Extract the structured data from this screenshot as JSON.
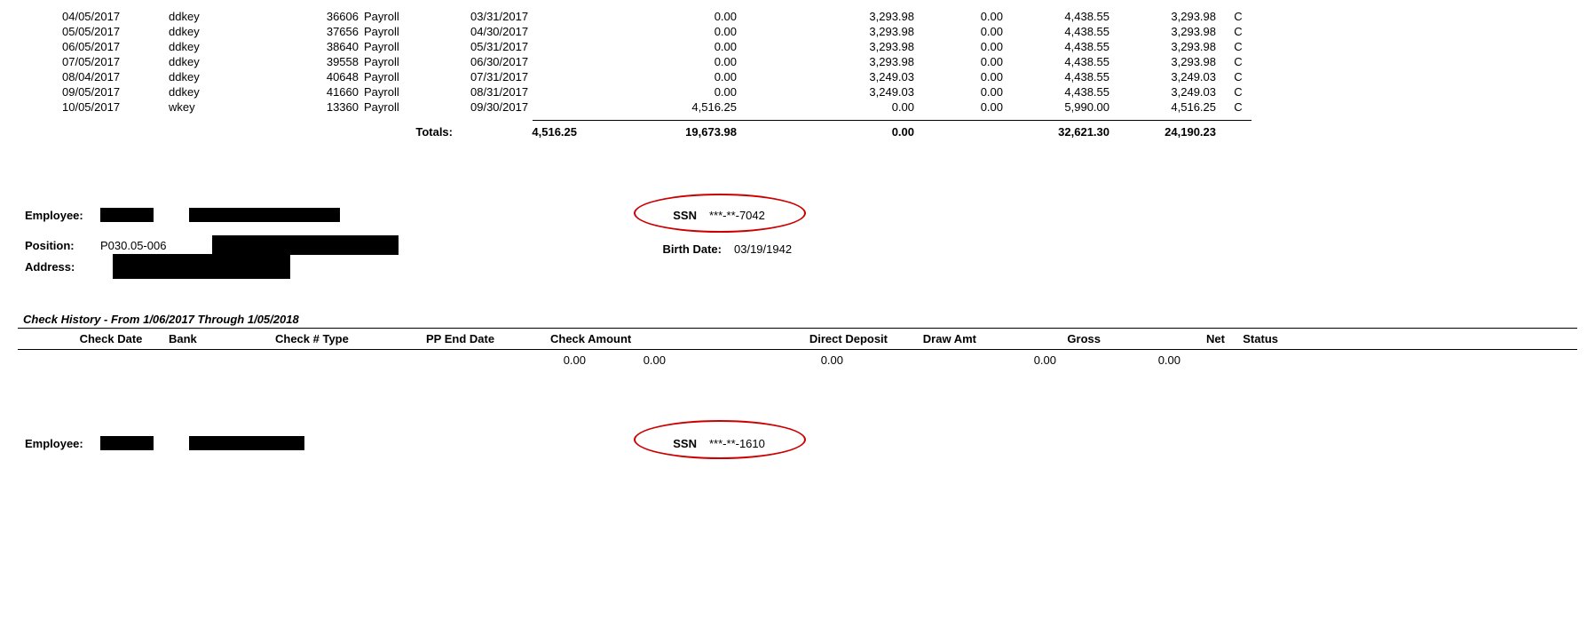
{
  "rows": [
    {
      "date": "04/05/2017",
      "bank": "ddkey",
      "chk": "36606",
      "type": "Payroll",
      "pp": "03/31/2017",
      "a1": "",
      "a2": "0.00",
      "dd": "3,293.98",
      "draw": "0.00",
      "gross": "4,438.55",
      "net": "3,293.98",
      "st": "C"
    },
    {
      "date": "05/05/2017",
      "bank": "ddkey",
      "chk": "37656",
      "type": "Payroll",
      "pp": "04/30/2017",
      "a1": "",
      "a2": "0.00",
      "dd": "3,293.98",
      "draw": "0.00",
      "gross": "4,438.55",
      "net": "3,293.98",
      "st": "C"
    },
    {
      "date": "06/05/2017",
      "bank": "ddkey",
      "chk": "38640",
      "type": "Payroll",
      "pp": "05/31/2017",
      "a1": "",
      "a2": "0.00",
      "dd": "3,293.98",
      "draw": "0.00",
      "gross": "4,438.55",
      "net": "3,293.98",
      "st": "C"
    },
    {
      "date": "07/05/2017",
      "bank": "ddkey",
      "chk": "39558",
      "type": "Payroll",
      "pp": "06/30/2017",
      "a1": "",
      "a2": "0.00",
      "dd": "3,293.98",
      "draw": "0.00",
      "gross": "4,438.55",
      "net": "3,293.98",
      "st": "C"
    },
    {
      "date": "08/04/2017",
      "bank": "ddkey",
      "chk": "40648",
      "type": "Payroll",
      "pp": "07/31/2017",
      "a1": "",
      "a2": "0.00",
      "dd": "3,249.03",
      "draw": "0.00",
      "gross": "4,438.55",
      "net": "3,249.03",
      "st": "C"
    },
    {
      "date": "09/05/2017",
      "bank": "ddkey",
      "chk": "41660",
      "type": "Payroll",
      "pp": "08/31/2017",
      "a1": "",
      "a2": "0.00",
      "dd": "3,249.03",
      "draw": "0.00",
      "gross": "4,438.55",
      "net": "3,249.03",
      "st": "C"
    },
    {
      "date": "10/05/2017",
      "bank": "wkey",
      "chk": "13360",
      "type": "Payroll",
      "pp": "09/30/2017",
      "a1": "",
      "a2": "4,516.25",
      "dd": "0.00",
      "draw": "0.00",
      "gross": "5,990.00",
      "net": "4,516.25",
      "st": "C"
    }
  ],
  "totals": {
    "lbl": "Totals:",
    "a": "4,516.25",
    "b": "19,673.98",
    "c": "0.00",
    "d": "",
    "e": "32,621.30",
    "f": "24,190.23"
  },
  "emp1": {
    "employee_lbl": "Employee:",
    "position_lbl": "Position:",
    "position_val": "P030.05-006",
    "address_lbl": "Address:",
    "ssn_lbl": "SSN",
    "ssn_val": "***-**-7042",
    "birth_lbl": "Birth Date:",
    "birth_val": "03/19/1942"
  },
  "hist": {
    "title": "Check History  -  From 1/06/2017 Through 1/05/2018",
    "hdr": {
      "chkdate": "Check Date",
      "bank": "Bank",
      "ct": "Check # Type",
      "pp": "PP End Date",
      "ca": "Check Amount",
      "dd": "Direct Deposit",
      "da": "Draw Amt",
      "gr": "Gross",
      "net": "Net",
      "st": "Status"
    },
    "zero": {
      "a": "0.00",
      "b": "0.00",
      "c": "0.00",
      "d": "0.00",
      "e": "0.00"
    }
  },
  "emp2": {
    "employee_lbl": "Employee:",
    "ssn_lbl": "SSN",
    "ssn_val": "***-**-1610"
  }
}
